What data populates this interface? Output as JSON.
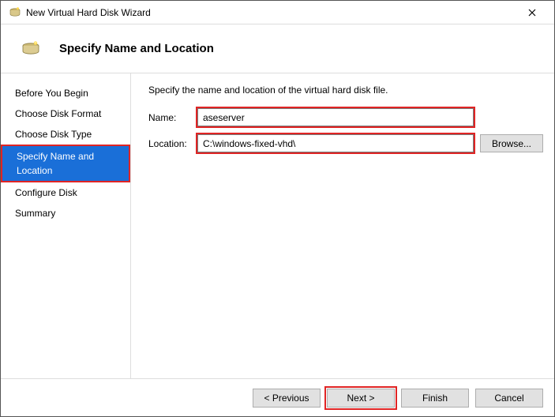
{
  "window": {
    "title": "New Virtual Hard Disk Wizard"
  },
  "header": {
    "heading": "Specify Name and Location"
  },
  "sidebar": {
    "items": [
      {
        "label": "Before You Begin"
      },
      {
        "label": "Choose Disk Format"
      },
      {
        "label": "Choose Disk Type"
      },
      {
        "label": "Specify Name and Location"
      },
      {
        "label": "Configure Disk"
      },
      {
        "label": "Summary"
      }
    ],
    "active_index": 3
  },
  "content": {
    "instruction": "Specify the name and location of the virtual hard disk file.",
    "name_label": "Name:",
    "name_value": "aseserver",
    "location_label": "Location:",
    "location_value": "C:\\windows-fixed-vhd\\",
    "browse_label": "Browse..."
  },
  "footer": {
    "previous": "< Previous",
    "next": "Next >",
    "finish": "Finish",
    "cancel": "Cancel"
  },
  "highlights": {
    "step": true,
    "name_input": true,
    "location_input": true,
    "next_button": true
  }
}
